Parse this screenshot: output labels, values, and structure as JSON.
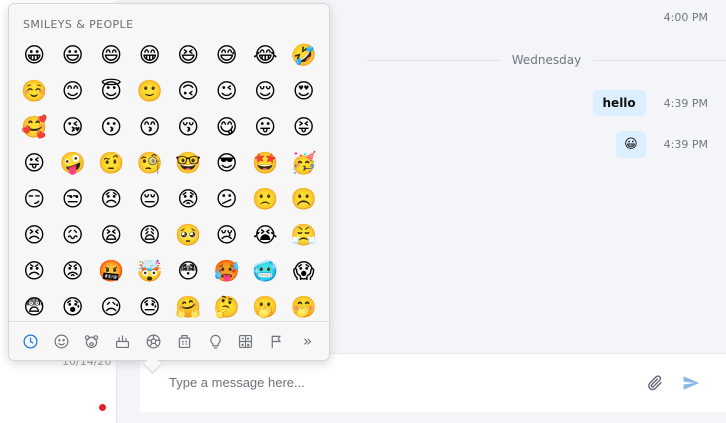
{
  "sidebar": {
    "date": "10/14/20",
    "status_color": "#e02424"
  },
  "chat": {
    "top_time": "4:00 PM",
    "divider": "Wednesday",
    "messages": [
      {
        "text": "hello",
        "time": "4:39 PM"
      },
      {
        "text": "😀",
        "time": "4:39 PM"
      }
    ]
  },
  "compose": {
    "placeholder": "Type a message here..."
  },
  "emoji_picker": {
    "title": "SMILEYS & PEOPLE",
    "emojis": [
      "😀",
      "😃",
      "😄",
      "😁",
      "😆",
      "😅",
      "😂",
      "🤣",
      "☺️",
      "😊",
      "😇",
      "🙂",
      "🙃",
      "😉",
      "😌",
      "😍",
      "🥰",
      "😘",
      "😗",
      "😙",
      "😚",
      "😋",
      "😛",
      "😝",
      "😜",
      "🤪",
      "🤨",
      "🧐",
      "🤓",
      "😎",
      "🤩",
      "🥳",
      "😏",
      "😒",
      "😞",
      "😔",
      "😟",
      "😕",
      "🙁",
      "☹️",
      "😣",
      "😖",
      "😫",
      "😩",
      "🥺",
      "😢",
      "😭",
      "😤",
      "😠",
      "😡",
      "🤬",
      "🤯",
      "😳",
      "🥵",
      "🥶",
      "😱",
      "😨",
      "😰",
      "😥",
      "😓",
      "🤗",
      "🤔",
      "🫢",
      "🤭"
    ],
    "categories": [
      "clock-icon",
      "smiley-icon",
      "bear-icon",
      "food-icon",
      "ball-icon",
      "building-icon",
      "lightbulb-icon",
      "symbols-icon",
      "flag-icon"
    ],
    "more": "»",
    "accent": "#1d7bd8"
  }
}
